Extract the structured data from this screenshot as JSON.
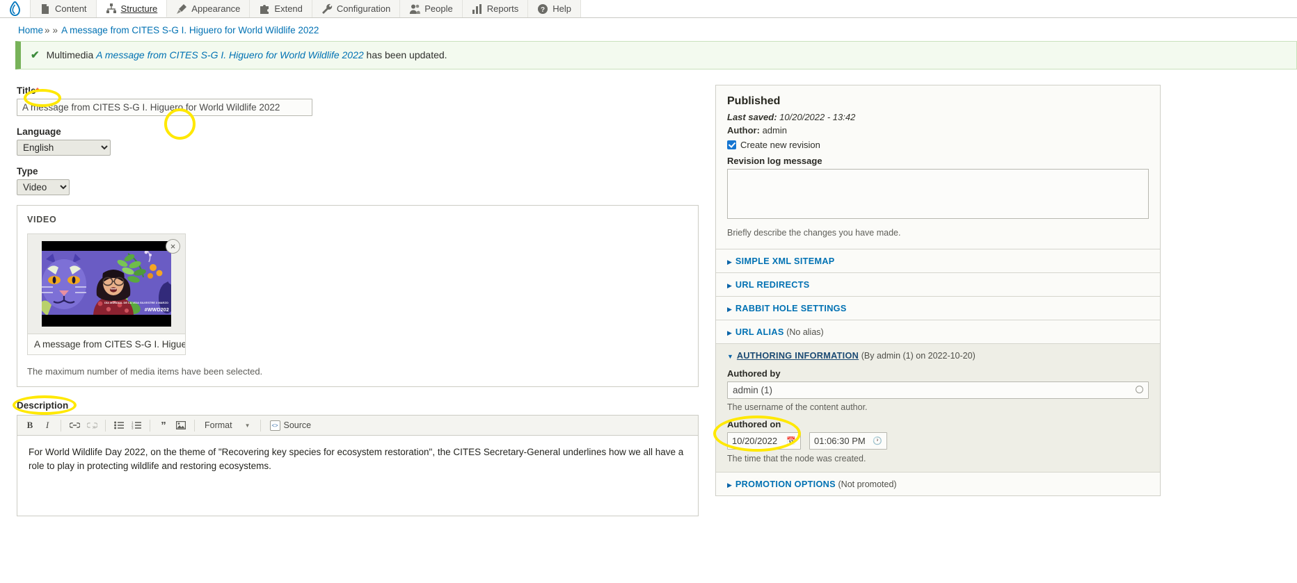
{
  "toolbar": {
    "logo_name": "drupal-drop-logo",
    "items": [
      {
        "label": "Content",
        "icon": "file-icon",
        "active": false
      },
      {
        "label": "Structure",
        "icon": "structure-icon",
        "active": true
      },
      {
        "label": "Appearance",
        "icon": "brush-icon",
        "active": false
      },
      {
        "label": "Extend",
        "icon": "puzzle-icon",
        "active": false
      },
      {
        "label": "Configuration",
        "icon": "wrench-icon",
        "active": false
      },
      {
        "label": "People",
        "icon": "people-icon",
        "active": false
      },
      {
        "label": "Reports",
        "icon": "bar-chart-icon",
        "active": false
      },
      {
        "label": "Help",
        "icon": "question-mark-icon",
        "active": false
      }
    ]
  },
  "breadcrumb": {
    "home": "Home",
    "sep1": "»",
    "sep2": "»",
    "current": "A message from CITES S-G I. Higuero for World Wildlife 2022"
  },
  "status": {
    "check": "✔",
    "prefix": "Multimedia",
    "entity": "A message from CITES S-G I. Higuero for World Wildlife 2022",
    "suffix": "has been updated."
  },
  "form": {
    "title": {
      "label": "Title",
      "required_marker": "*",
      "value": "A message from CITES S-G I. Higuero for World Wildlife 2022"
    },
    "language": {
      "label": "Language",
      "value": "English",
      "options": [
        "English"
      ]
    },
    "type": {
      "label": "Type",
      "value": "Video",
      "options": [
        "Video"
      ]
    },
    "video_fieldset": {
      "legend": "VIDEO",
      "remove_label": "×",
      "media_caption": "A message from CITES S-G I. Higue…",
      "note": "The maximum number of media items have been selected.",
      "thumb_overlay_text": "DÍA MUNDIAL DE LA VIDA SILVESTRE 3 MARZO",
      "thumb_hashtag": "#WWD202"
    },
    "description": {
      "label": "Description",
      "toolbar": [
        {
          "name": "bold-icon",
          "glyph": "B"
        },
        {
          "name": "italic-icon",
          "glyph": "I"
        },
        {
          "name": "link-icon",
          "glyph": "🔗"
        },
        {
          "name": "unlink-icon",
          "glyph": "🔗"
        },
        {
          "name": "bulleted-list-icon",
          "glyph": "≔"
        },
        {
          "name": "numbered-list-icon",
          "glyph": "≔"
        },
        {
          "name": "blockquote-icon",
          "glyph": "❞"
        },
        {
          "name": "image-icon",
          "glyph": "🖼"
        }
      ],
      "format_label": "Format",
      "source_label": "Source",
      "body": "For World Wildlife Day 2022, on the theme of \"Recovering key species for ecosystem restoration\", the CITES Secretary-General underlines how we all have a role to play in protecting wildlife and restoring ecosystems."
    }
  },
  "sidebar": {
    "published": {
      "heading": "Published",
      "last_saved_label": "Last saved:",
      "last_saved_value": "10/20/2022 - 13:42",
      "author_label": "Author:",
      "author_value": "admin",
      "create_revision_label": "Create new revision",
      "create_revision_checked": true,
      "revision_log_label": "Revision log message",
      "revision_log_value": "",
      "revision_help": "Briefly describe the changes you have made."
    },
    "sections": [
      {
        "title": "SIMPLE XML SITEMAP",
        "summary": "",
        "open": false
      },
      {
        "title": "URL REDIRECTS",
        "summary": "",
        "open": false
      },
      {
        "title": "RABBIT HOLE SETTINGS",
        "summary": "",
        "open": false
      },
      {
        "title": "URL ALIAS",
        "summary": "(No alias)",
        "open": false
      }
    ],
    "authoring": {
      "title": "AUTHORING INFORMATION",
      "summary": "(By admin (1) on 2022-10-20)",
      "open": true,
      "authored_by_label": "Authored by",
      "authored_by_value": "admin (1)",
      "authored_by_help": "The username of the content author.",
      "authored_on_label": "Authored on",
      "date_value": "10/20/2022",
      "time_value": "01:06:30 PM",
      "authored_on_help": "The time that the node was created."
    },
    "promotion": {
      "title": "PROMOTION OPTIONS",
      "summary": "(Not promoted)",
      "open": false
    }
  },
  "annotations": {
    "accent_color": "#ffe800",
    "targets": [
      "title-label",
      "media-remove-button",
      "description-label",
      "authored-on-field"
    ]
  }
}
